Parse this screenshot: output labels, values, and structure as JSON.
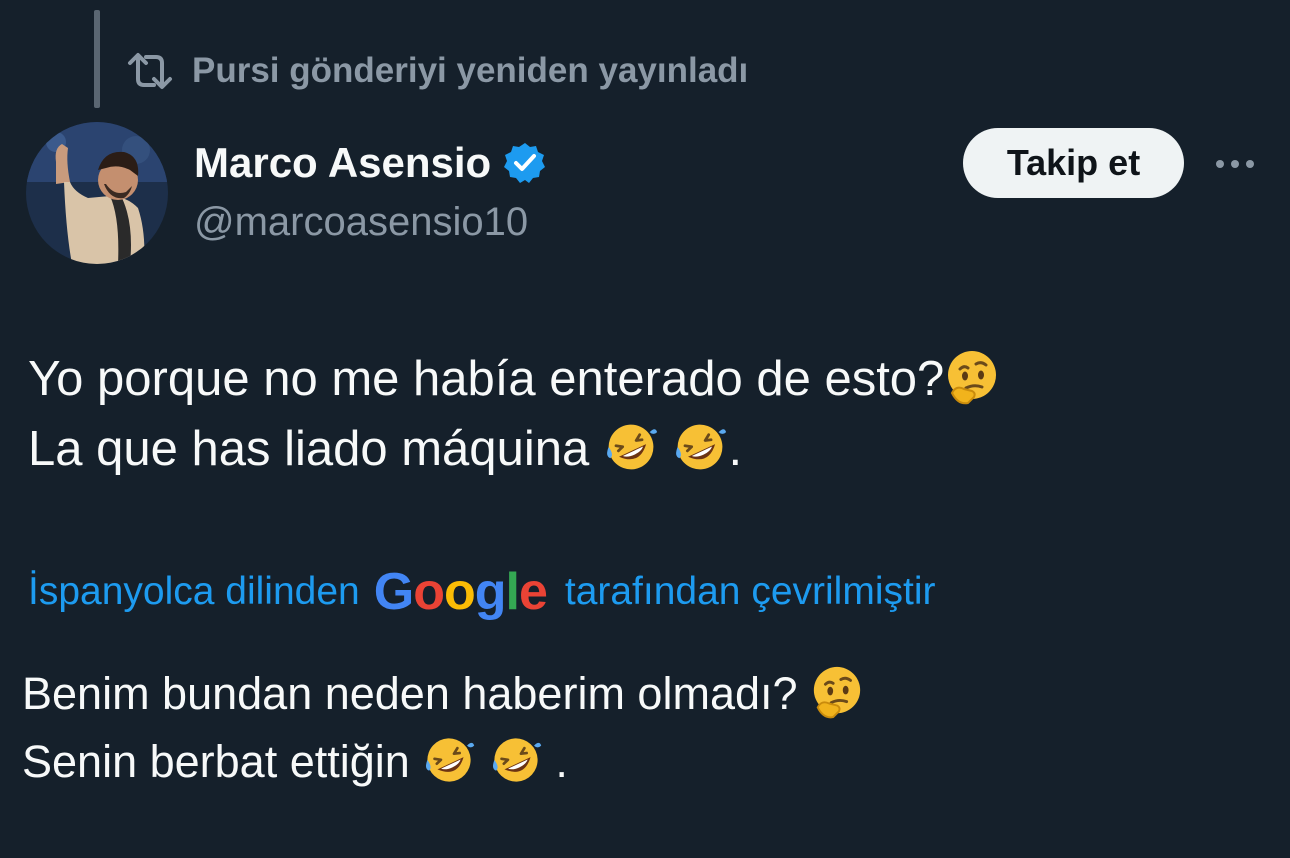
{
  "repost": {
    "text": "Pursi gönderiyi yeniden yayınladı",
    "icon": "repost-icon"
  },
  "author": {
    "name": "Marco Asensio",
    "handle": "@marcoasensio10",
    "verified": true,
    "verified_color": "#1d9bf0"
  },
  "actions": {
    "follow_label": "Takip et",
    "more_icon": "more-icon"
  },
  "tweet": {
    "line1": "Yo porque no me había enterado de esto?",
    "line2": "La que has liado máquina",
    "line2_end": "."
  },
  "translation": {
    "prefix": "İspanyolca dilinden",
    "google_logo": "Google",
    "suffix": "tarafından çevrilmiştir"
  },
  "translated": {
    "line1": "Benim bundan neden haberim olmadı?",
    "line2": "Senin berbat ettiğin",
    "line2_end": "."
  },
  "colors": {
    "background": "#15202b",
    "text": "#f7f9f9",
    "secondary": "#8b98a5",
    "accent": "#1d9bf0"
  }
}
